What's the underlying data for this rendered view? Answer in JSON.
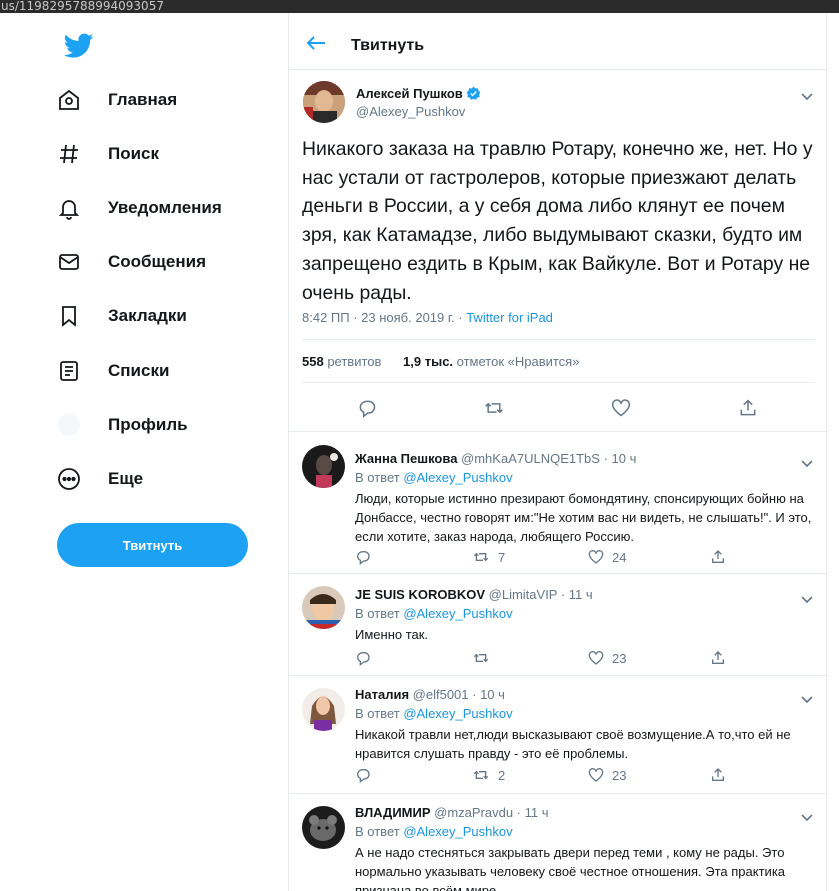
{
  "browser": {
    "url": "us/1198295788994093057"
  },
  "nav": {
    "items": [
      {
        "label": "Главная"
      },
      {
        "label": "Поиск"
      },
      {
        "label": "Уведомления"
      },
      {
        "label": "Сообщения"
      },
      {
        "label": "Закладки"
      },
      {
        "label": "Списки"
      },
      {
        "label": "Профиль"
      },
      {
        "label": "Еще"
      }
    ],
    "tweet_button": "Твитнуть"
  },
  "header": {
    "title": "Твитнуть"
  },
  "tweet": {
    "author_name": "Алексей Пушков",
    "author_handle": "@Alexey_Pushkov",
    "text": "Никакого заказа на травлю Ротару, конечно же, нет. Но у нас устали от гастролеров, которые приезжают делать деньги в России, а у себя дома либо клянут ее почем зря, как  Катамадзе, либо выдумывают сказки, будто им запрещено ездить в Крым, как Вайкуле. Вот и Ротару не очень рады.",
    "time": "8:42 ПП · 23 нояб. 2019 г. · ",
    "source": "Twitter for iPad",
    "retweets_count": "558",
    "retweets_label": " ретвитов",
    "likes_count": "1,9 тыс.",
    "likes_label": " отметок «Нравится»"
  },
  "replies": [
    {
      "name": "Жанна Пешкова",
      "handle": " @mhKaA7ULNQE1TbS · 10 ч",
      "in_reply_label": "В ответ ",
      "mention": "@Alexey_Pushkov",
      "text": "Люди, которые истинно презирают бомондятину, спонсирующих бойню на Донбассе, честно говорят им:\"Не хотим вас ни видеть, не слышать!\". И это, если хотите, заказ народа, любящего Россию.",
      "retweets": "7",
      "likes": "24"
    },
    {
      "name": "JE SUIS KOROBKOV",
      "handle": " @LimitaVIP · 11 ч",
      "in_reply_label": "В ответ ",
      "mention": "@Alexey_Pushkov",
      "text": "Именно так.",
      "retweets": "",
      "likes": "23"
    },
    {
      "name": "Наталия",
      "handle": " @elf5001 · 10 ч",
      "in_reply_label": "В ответ ",
      "mention": "@Alexey_Pushkov",
      "text": "Никакой травли нет,люди высказывают своё возмущение.А то,что ей не нравится слушать правду - это её проблемы.",
      "retweets": "2",
      "likes": "23"
    },
    {
      "name": "ВЛАДИМИР",
      "handle": " @mzaPravdu · 11 ч",
      "in_reply_label": "В ответ ",
      "mention": "@Alexey_Pushkov",
      "text": "А не надо стесняться закрывать двери перед теми , кому не рады. Это нормально указывать человеку своё честное отношения. Эта практика признана во всём мире.",
      "retweets": "",
      "likes": ""
    }
  ],
  "colors": {
    "accent": "#1da1f2",
    "link": "#1b95e0",
    "muted": "#657786",
    "border": "#e6ecf0"
  },
  "icons": [
    "twitter-logo-icon",
    "home-icon",
    "hashtag-icon",
    "bell-icon",
    "envelope-icon",
    "bookmark-icon",
    "list-icon",
    "profile-icon",
    "more-icon",
    "back-arrow-icon",
    "verified-icon",
    "chevron-down-icon",
    "reply-icon",
    "retweet-icon",
    "like-icon",
    "share-icon"
  ]
}
